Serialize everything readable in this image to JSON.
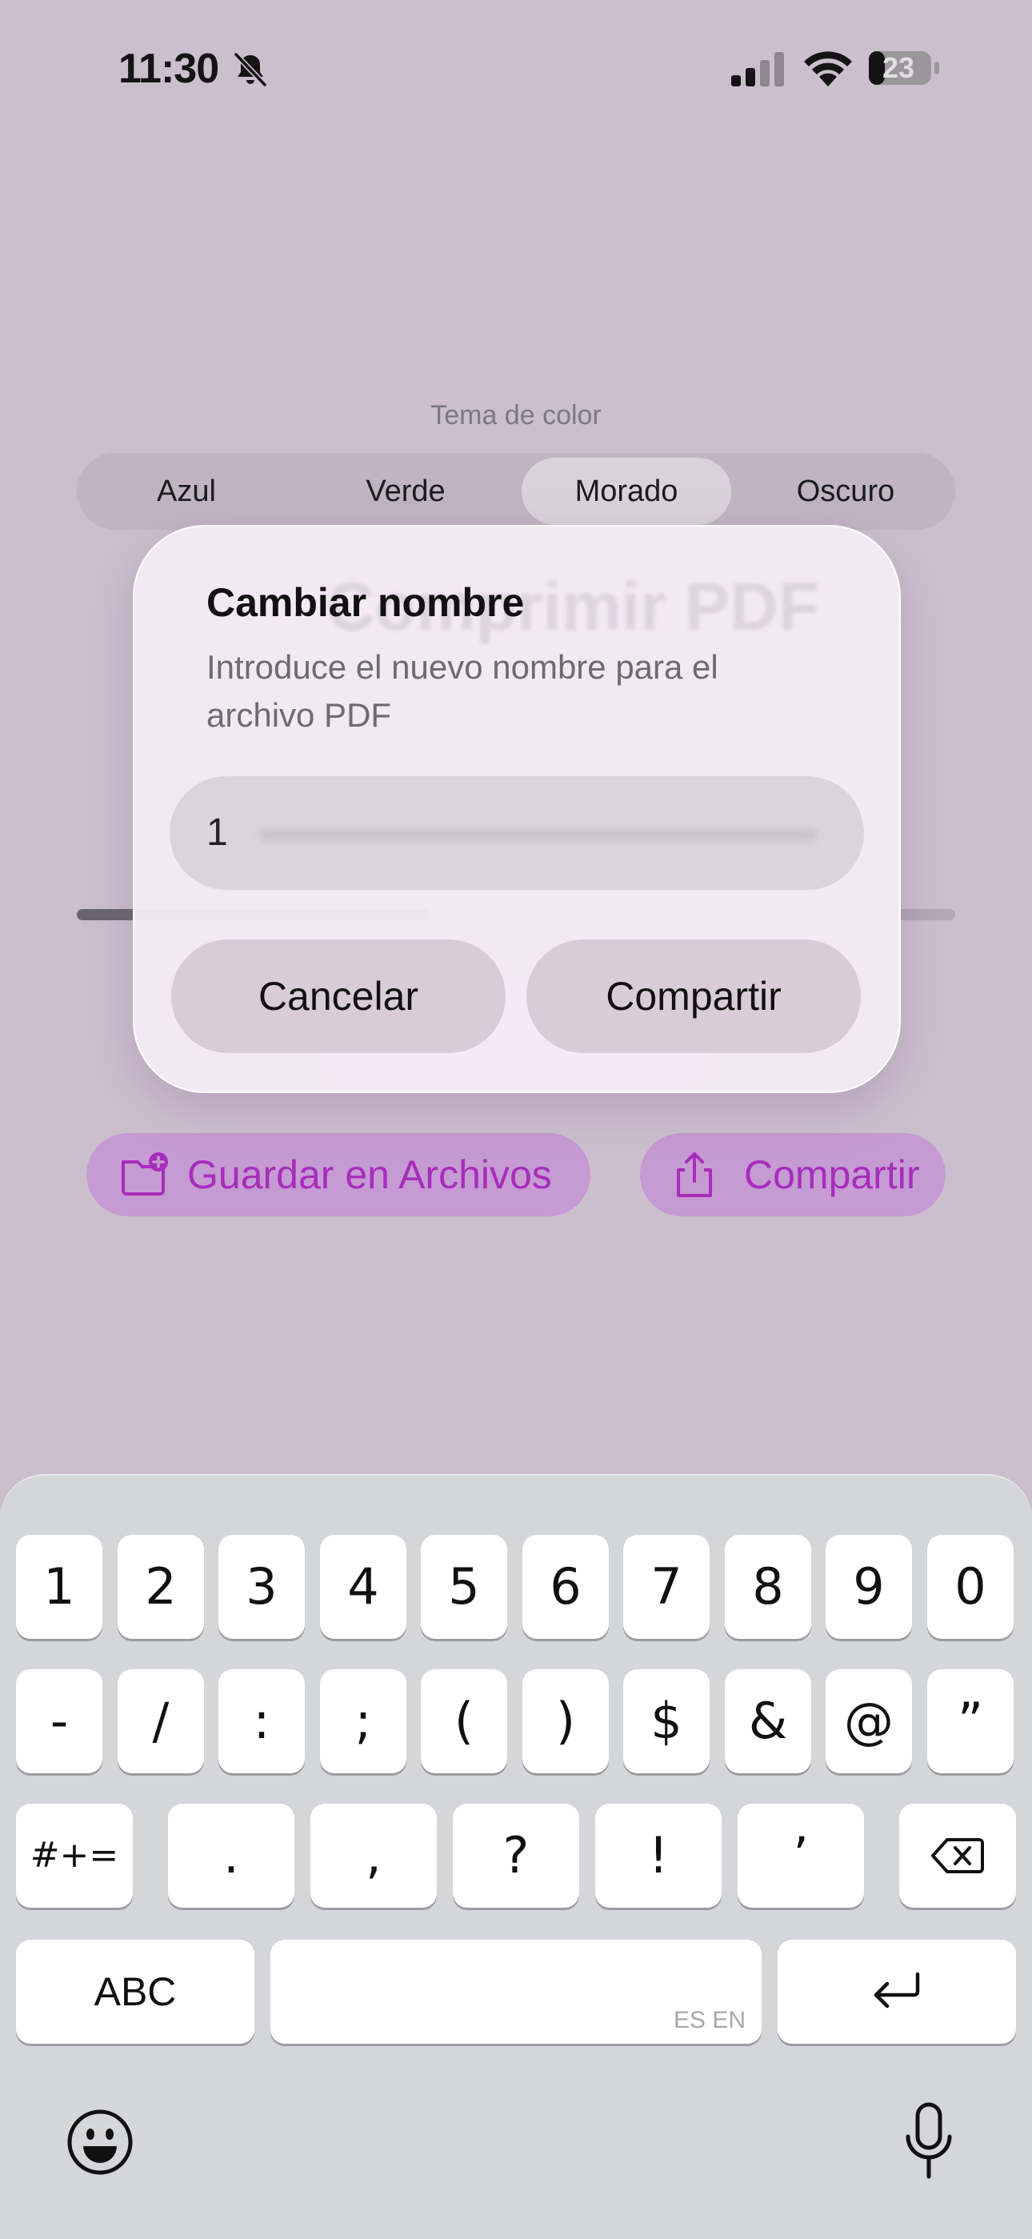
{
  "status_bar": {
    "time": "11:30",
    "battery": "23",
    "icons": [
      "bell-muted-icon",
      "cellular-signal-icon",
      "wifi-icon",
      "battery-icon"
    ]
  },
  "theme": {
    "label": "Tema de color",
    "options": [
      "Azul",
      "Verde",
      "Morado",
      "Oscuro"
    ],
    "selected": "Morado"
  },
  "background_title": "Comprimir PDF",
  "actions": {
    "save_label": "Guardar en Archivos",
    "share_label": "Compartir",
    "accent": "#a72dbc"
  },
  "dialog": {
    "title": "Cambiar nombre",
    "message": "Introduce el nuevo nombre para el archivo PDF",
    "input_value": "1",
    "cancel_label": "Cancelar",
    "confirm_label": "Compartir"
  },
  "keyboard": {
    "row1": [
      "1",
      "2",
      "3",
      "4",
      "5",
      "6",
      "7",
      "8",
      "9",
      "0"
    ],
    "row2": [
      "-",
      "/",
      ":",
      ";",
      "(",
      ")",
      "$",
      "&",
      "@",
      "”"
    ],
    "row3": [
      ".",
      ",",
      "?",
      "!",
      "’"
    ],
    "symbols_toggle": "#+=",
    "abc_label": "ABC",
    "space_languages": "ES EN",
    "icons": [
      "delete-icon",
      "return-icon",
      "emoji-icon",
      "microphone-icon"
    ]
  }
}
